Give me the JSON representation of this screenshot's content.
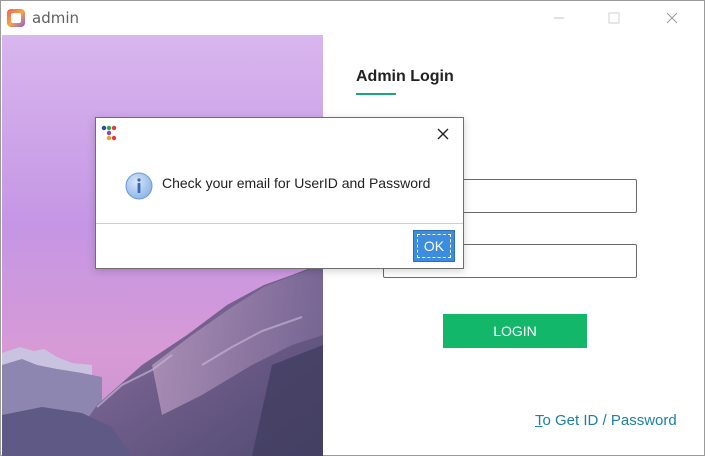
{
  "window": {
    "title": "admin"
  },
  "login": {
    "heading": "Admin Login",
    "login_button": "LOGIN",
    "get_id_link_mnemonic": "T",
    "get_id_link_rest": "o Get ID / Password",
    "userid_value": "",
    "password_value": ""
  },
  "dialog": {
    "message": "Check your email for UserID and Password",
    "ok_button": "OK"
  },
  "icons": {
    "app": "app-logo-icon",
    "minimize": "minimize-icon",
    "maximize": "maximize-icon",
    "close": "close-icon",
    "dialog_app": "dialog-app-icon",
    "dialog_close": "dialog-close-icon",
    "info": "info-icon"
  },
  "colors": {
    "accent_green": "#12b76a",
    "link_blue": "#1c7fa5",
    "ok_blue": "#3c8dde"
  }
}
